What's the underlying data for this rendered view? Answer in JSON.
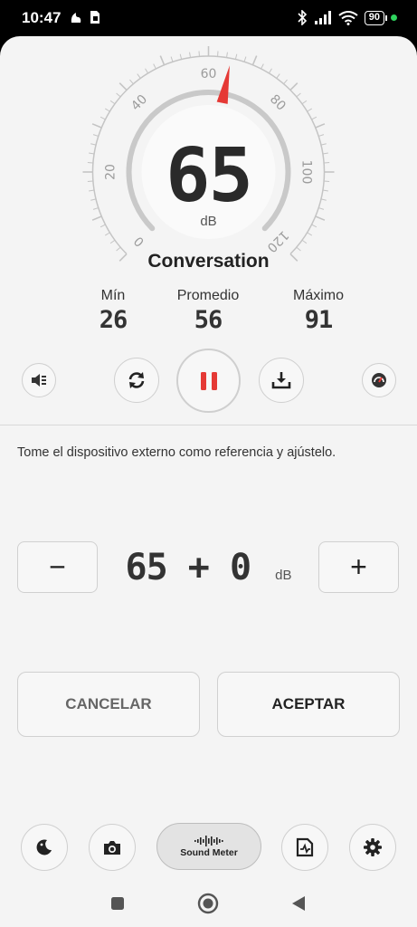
{
  "status_bar": {
    "time": "10:47",
    "battery": "90"
  },
  "meter": {
    "value": "65",
    "unit": "dB",
    "needle_value": 65,
    "scale_min": 0,
    "scale_max": 120,
    "scale_ticks": [
      "0",
      "20",
      "40",
      "60",
      "80",
      "100",
      "120"
    ],
    "level_name": "Conversation",
    "accent_color": "#e53935"
  },
  "stats": {
    "min_label": "Mín",
    "min_value": "26",
    "avg_label": "Promedio",
    "avg_value": "56",
    "max_label": "Máximo",
    "max_value": "91"
  },
  "controls": {
    "speaker_icon": "speaker-icon",
    "reset_icon": "refresh-icon",
    "pause_icon": "pause-icon",
    "save_icon": "download-icon",
    "gauge_icon": "gauge-icon"
  },
  "calibration": {
    "hint": "Tome el dispositivo externo como referencia y ajústelo.",
    "minus_label": "−",
    "plus_label": "+",
    "base_value": "65",
    "operator": "+",
    "offset_value": "0",
    "unit": "dB",
    "cancel_label": "CANCELAR",
    "accept_label": "ACEPTAR"
  },
  "toolbar": {
    "logo_text": "Sound Meter",
    "icons": [
      "night-mode-icon",
      "camera-icon",
      "sound-meter-logo",
      "report-icon",
      "settings-icon"
    ]
  }
}
